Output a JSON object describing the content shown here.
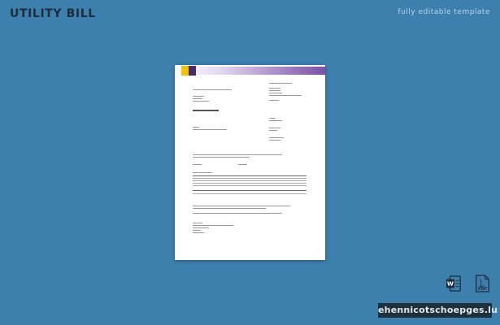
{
  "header": {
    "title": "UTILITY BILL",
    "tagline": "fully editable template"
  },
  "footer": {
    "site": "ehennicotschoepges.lu"
  },
  "icons": [
    "word-icon",
    "pdf-icon"
  ],
  "colors": {
    "background": "#3d7fad",
    "accent": "#7a4fa6",
    "badge": "#1f2f3c"
  }
}
